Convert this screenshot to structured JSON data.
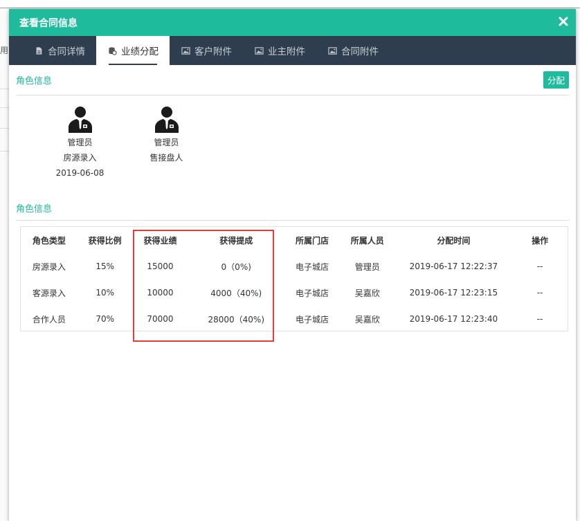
{
  "background": {
    "fragment_text": "用"
  },
  "modal": {
    "title": "查看合同信息",
    "close_icon": "close-icon"
  },
  "tabs": [
    {
      "label": "合同详情",
      "icon": "document-icon",
      "active": false
    },
    {
      "label": "业绩分配",
      "icon": "coins-icon",
      "active": true
    },
    {
      "label": "客户附件",
      "icon": "image-icon",
      "active": false
    },
    {
      "label": "业主附件",
      "icon": "image-icon",
      "active": false
    },
    {
      "label": "合同附件",
      "icon": "image-icon",
      "active": false
    }
  ],
  "roles_section": {
    "title": "角色信息",
    "assign_label": "分配",
    "cards": [
      {
        "name": "管理员",
        "role": "房源录入",
        "date": "2019-06-08"
      },
      {
        "name": "管理员",
        "role": "售接盘人",
        "date": ""
      }
    ]
  },
  "table_section": {
    "title": "角色信息",
    "columns": [
      "角色类型",
      "获得比例",
      "获得业绩",
      "获得提成",
      "所属门店",
      "所属人员",
      "分配时间",
      "操作"
    ],
    "rows": [
      [
        "房源录入",
        "15%",
        "15000",
        "0（0%)",
        "电子城店",
        "管理员",
        "2019-06-17 12:22:37",
        "--"
      ],
      [
        "客源录入",
        "10%",
        "10000",
        "4000（40%)",
        "电子城店",
        "吴嘉欣",
        "2019-06-17 12:23:15",
        "--"
      ],
      [
        "合作人员",
        "70%",
        "70000",
        "28000（40%)",
        "电子城店",
        "吴嘉欣",
        "2019-06-17 12:23:40",
        "--"
      ]
    ]
  },
  "colors": {
    "accent": "#1ebc9c",
    "tabbar": "#2e3e4e",
    "highlight": "#e8393c"
  }
}
